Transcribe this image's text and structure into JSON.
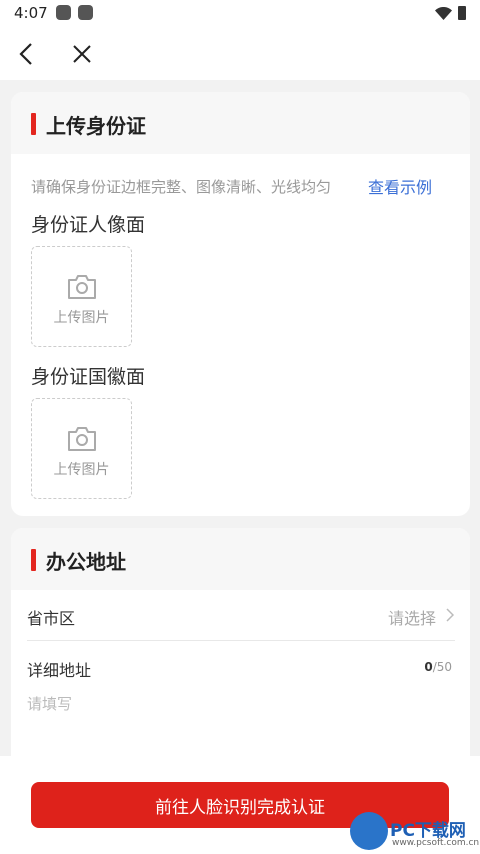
{
  "status_bar": {
    "time": "4:07"
  },
  "nav": {
    "back": "back-icon",
    "close": "close-icon"
  },
  "id_card": {
    "title": "上传身份证",
    "hint": "请确保身份证边框完整、图像清晰、光线均匀",
    "example_link": "查看示例",
    "front": {
      "label": "身份证人像面",
      "upload_text": "上传图片"
    },
    "back": {
      "label": "身份证国徽面",
      "upload_text": "上传图片"
    }
  },
  "address": {
    "title": "办公地址",
    "region_label": "省市区",
    "region_placeholder": "请选择",
    "detail_label": "详细地址",
    "counter_current": "0",
    "counter_max": "/50",
    "detail_placeholder": "请填写"
  },
  "submit_label": "前往人脸识别完成认证",
  "watermark": {
    "name": "PC下载网",
    "url": "www.pcsoft.com.cn"
  },
  "colors": {
    "accent": "#de221b",
    "link": "#3b6fd6"
  }
}
